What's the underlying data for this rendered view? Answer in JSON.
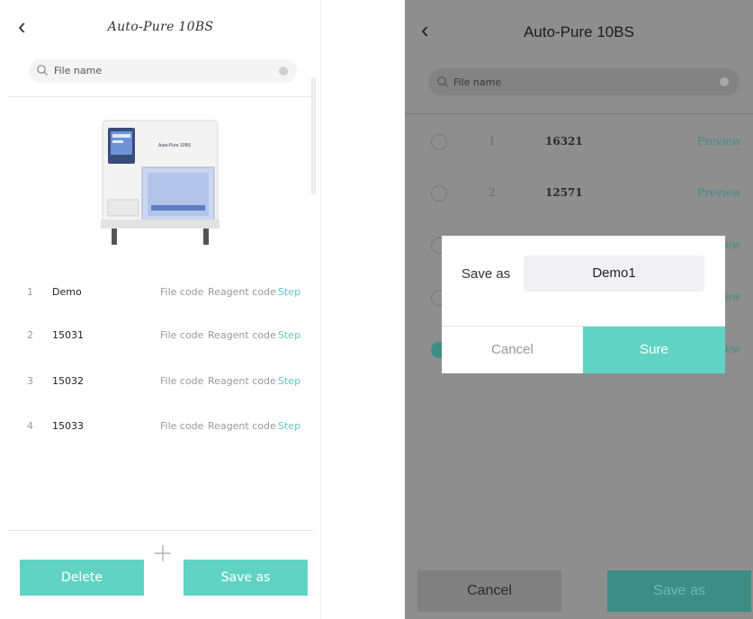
{
  "left_screen": {
    "title": "Auto-Pure 10BS",
    "search": {
      "placeholder": "File name"
    },
    "machine_label": "Auto-Pure 10BS",
    "rows": [
      {
        "index": "1",
        "name": "Demo",
        "file_code": "File code",
        "reagent_code": "Reagent code",
        "step": "Step"
      },
      {
        "index": "2",
        "name": "15031",
        "file_code": "File code",
        "reagent_code": "Reagent code",
        "step": "Step"
      },
      {
        "index": "3",
        "name": "15032",
        "file_code": "File code",
        "reagent_code": "Reagent code",
        "step": "Step"
      },
      {
        "index": "4",
        "name": "15033",
        "file_code": "File code",
        "reagent_code": "Reagent code",
        "step": "Step"
      }
    ],
    "buttons": {
      "delete": "Delete",
      "save_as": "Save as"
    }
  },
  "right_screen": {
    "title": "Auto-Pure 10BS",
    "search": {
      "placeholder": "File name"
    },
    "rows": [
      {
        "index": "1",
        "value": "16321",
        "preview": "Preview",
        "checked": false
      },
      {
        "index": "2",
        "value": "12571",
        "preview": "Preview",
        "checked": false
      },
      {
        "index": "",
        "value": "",
        "preview": "ew",
        "checked": false
      },
      {
        "index": "",
        "value": "",
        "preview": "ew",
        "checked": false
      },
      {
        "index": "",
        "value": "",
        "preview": "ew",
        "checked": true
      }
    ],
    "buttons": {
      "cancel": "Cancel",
      "save_as": "Save as"
    },
    "dialog": {
      "label": "Save as",
      "input_value": "Demo1",
      "cancel": "Cancel",
      "sure": "Sure"
    }
  },
  "colors": {
    "accent": "#61d3c4",
    "accent_dark": "#3c8d84",
    "overlay": "#8e8e8e"
  }
}
